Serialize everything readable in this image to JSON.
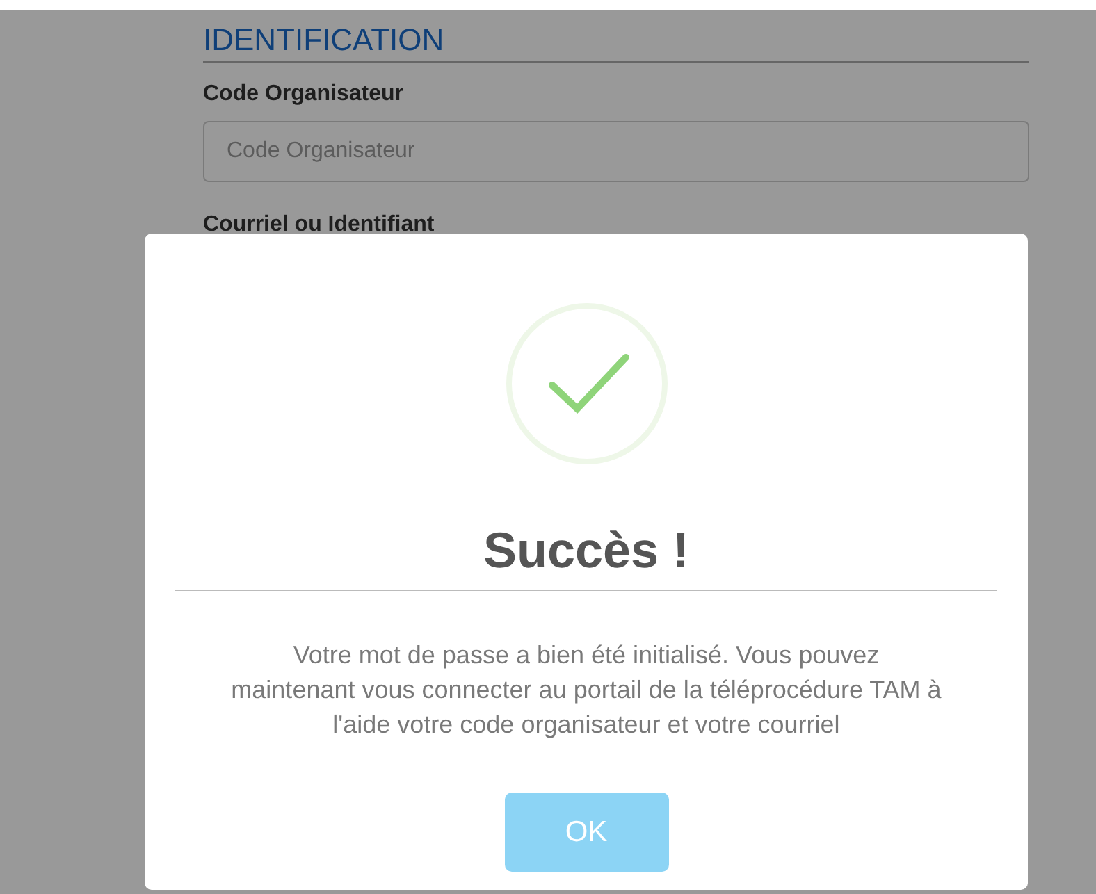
{
  "page": {
    "section_title": "IDENTIFICATION",
    "fields": [
      {
        "label": "Code Organisateur",
        "placeholder": "Code Organisateur"
      },
      {
        "label": "Courriel ou Identifiant"
      }
    ]
  },
  "dialog": {
    "kind": "success",
    "title": "Succès !",
    "message": "Votre mot de passe a bien été initialisé. Vous pouvez maintenant vous connecter au portail de la téléprocédure TAM à l'aide votre code organisateur et votre courriel",
    "buttons": [
      {
        "label": "OK"
      }
    ]
  }
}
